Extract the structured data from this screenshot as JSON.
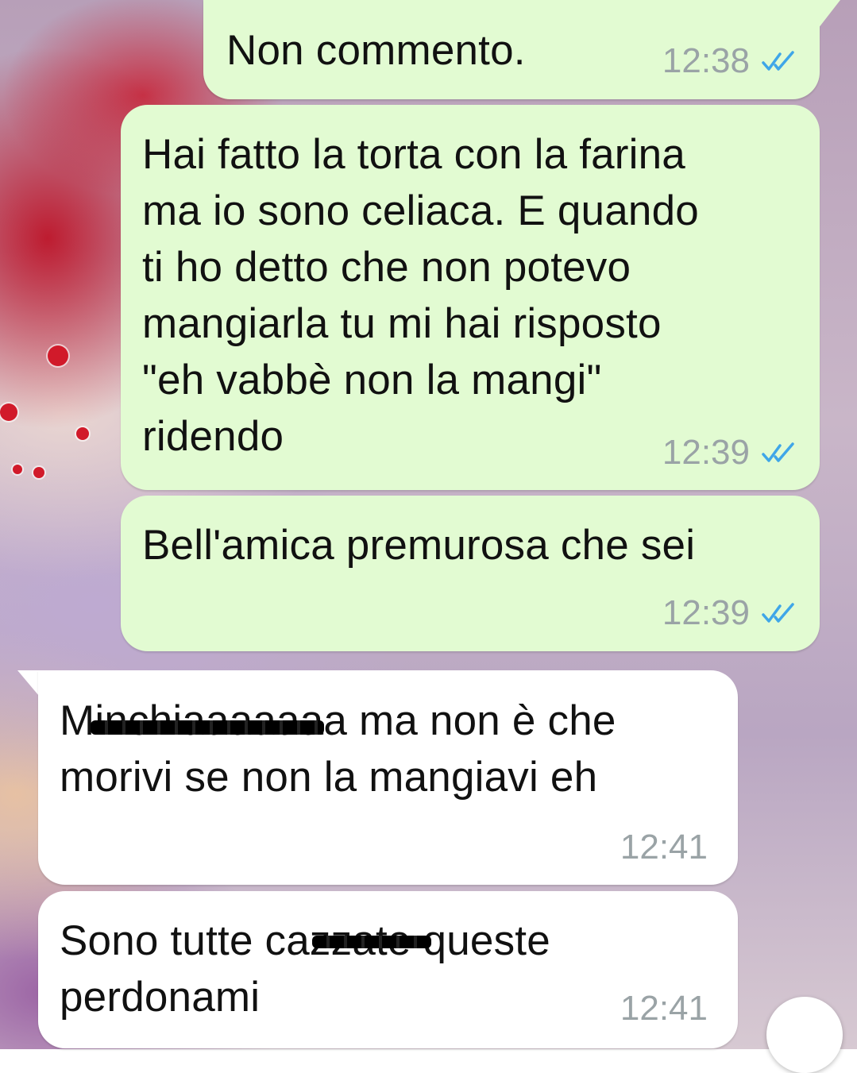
{
  "messages": [
    {
      "direction": "outgoing",
      "text": "Non commento.",
      "time": "12:38",
      "status": "read"
    },
    {
      "direction": "outgoing",
      "text": "Hai fatto la torta con la farina\nma io sono celiaca. E quando\nti ho detto che non potevo\nmangiarla tu mi hai risposto\n\"eh vabbè non la mangi\"\nridendo",
      "time": "12:39",
      "status": "read"
    },
    {
      "direction": "outgoing",
      "text": "Bell'amica premurosa che sei",
      "time": "12:39",
      "status": "read"
    },
    {
      "direction": "incoming",
      "text": "Minchiaaaaaaa ma non è che\nmorivi se non la mangiavi eh",
      "time": "12:41"
    },
    {
      "direction": "incoming",
      "text": "Sono tutte cazzate queste\nperdonami",
      "time": "12:41"
    }
  ],
  "colors": {
    "outgoing_bubble": "#e2fbd2",
    "incoming_bubble": "#ffffff",
    "timestamp": "#9aa3a6",
    "read_ticks": "#3fa6e8"
  },
  "icons": {
    "read_receipt": "double-check-icon",
    "scroll": "scroll-down-icon"
  }
}
